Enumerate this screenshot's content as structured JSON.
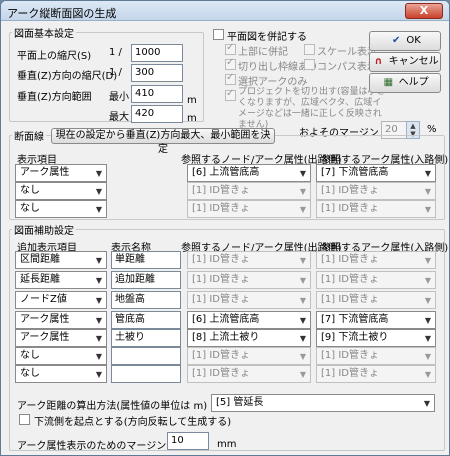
{
  "window": {
    "title": "アーク縦断面図の生成",
    "close": "X"
  },
  "basic": {
    "group_label": "図面基本設定",
    "plan_scale_label": "平面上の縮尺(S)",
    "vert_scale_label": "垂直(Z)方向の縮尺(D)",
    "one_slash": "1 /",
    "plan_scale": "1000",
    "vert_scale": "300",
    "vert_range_label": "垂直(Z)方向範囲",
    "min_label": "最小",
    "max_label": "最大",
    "min_value": "410",
    "max_value": "420",
    "unit_m": "m"
  },
  "plan": {
    "main_label": "平面図を併記する",
    "opt_top": "上部に併記",
    "opt_scale": "スケール表示",
    "opt_cut": "切り出し枠線あり",
    "opt_compass": "コンパス表示",
    "opt_selected": "選択アークのみ",
    "note": "プロジェクトを切り出す(容量は小さくなりますが、広域ベクタ、広域イメージなどは一緒に正しく反映されません)",
    "margin_label": "およそのマージン",
    "margin_value": "20",
    "margin_unit": "%"
  },
  "buttons": {
    "ok": "OK",
    "cancel": "キャンセル",
    "help": "ヘルプ"
  },
  "section": {
    "label": "断面線",
    "set_button": "現在の設定から垂直(Z)方向最大、最小範囲を決定",
    "display_label": "表示項目",
    "ref_out_label": "参照するノード/アーク属性(出路側)",
    "ref_in_label": "参照するアーク属性(入路側)",
    "rows": [
      {
        "item": "アーク属性",
        "out": "[6] 上流管底高",
        "in": "[7] 下流管底高"
      },
      {
        "item": "なし",
        "out": "[1] ID管きょ",
        "in": "[1] ID管きょ"
      },
      {
        "item": "なし",
        "out": "[1] ID管きょ",
        "in": "[1] ID管きょ"
      }
    ]
  },
  "aux": {
    "group_label": "図面補助設定",
    "add_label": "追加表示項目",
    "name_label": "表示名称",
    "ref_out_label": "参照するノード/アーク属性(出路側)",
    "ref_in_label": "参照するアーク属性(入路側)",
    "rows": [
      {
        "item": "区間距離",
        "name": "単距離",
        "out": "[1] ID管きょ",
        "in": "[1] ID管きょ"
      },
      {
        "item": "延長距離",
        "name": "追加距離",
        "out": "[1] ID管きょ",
        "in": "[1] ID管きょ"
      },
      {
        "item": "ノードZ値",
        "name": "地盤高",
        "out": "[1] ID管きょ",
        "in": "[1] ID管きょ"
      },
      {
        "item": "アーク属性",
        "name": "管底高",
        "out": "[6] 上流管底高",
        "in": "[7] 下流管底高"
      },
      {
        "item": "アーク属性",
        "name": "土被り",
        "out": "[8] 上流土被り",
        "in": "[9] 下流土被り"
      },
      {
        "item": "なし",
        "name": "",
        "out": "[1] ID管きょ",
        "in": "[1] ID管きょ"
      },
      {
        "item": "なし",
        "name": "",
        "out": "[1] ID管きょ",
        "in": "[1] ID管きょ"
      }
    ],
    "distance_method_label": "アーク距離の算出方法(属性値の単位は m)",
    "distance_method_value": "[5] 管延長",
    "downstream_label": "下流側を起点とする(方向反転して生成する)",
    "margin_label": "アーク属性表示のためのマージン",
    "margin_value": "10",
    "margin_unit": "mm"
  }
}
